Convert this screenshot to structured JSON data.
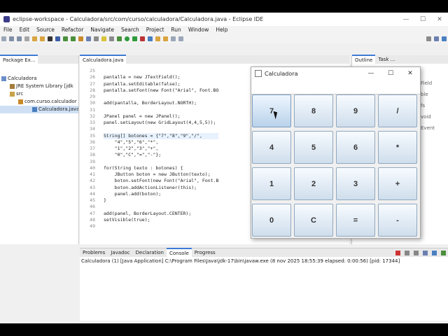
{
  "window": {
    "title": "eclipse-workspace - Calculadora/src/com/curso/calculadora/Calculadora.java - Eclipse IDE",
    "controls": [
      "—",
      "☐",
      "✕"
    ]
  },
  "menu": [
    "File",
    "Edit",
    "Source",
    "Refactor",
    "Navigate",
    "Search",
    "Project",
    "Run",
    "Window",
    "Help"
  ],
  "left_panel": {
    "tab_label": "Package Ex...",
    "tree": [
      {
        "label": "Calculadora",
        "indent": 0
      },
      {
        "label": "JRE System Library [jdk",
        "indent": 1
      },
      {
        "label": "src",
        "indent": 1
      },
      {
        "label": "com.curso.calculador",
        "indent": 2
      },
      {
        "label": "Calculadora.java",
        "indent": 3
      }
    ]
  },
  "editor": {
    "tab_label": "Calculadora.java",
    "line_numbers": [
      "25",
      "26",
      "27",
      "28",
      "29",
      "30",
      "31",
      "32",
      "33",
      "34",
      "35",
      "36",
      "37",
      "38",
      "39",
      "40",
      "41",
      "42",
      "43",
      "44",
      "45",
      "46",
      "47",
      "48",
      "49"
    ],
    "lines": [
      "",
      "pantalla = new JTextField();",
      "pantalla.setEditable(false);",
      "pantalla.setFont(new Font(\"Arial\", Font.BO",
      "",
      "add(pantalla, BorderLayout.NORTH);",
      "",
      "JPanel panel = new JPanel();",
      "panel.setLayout(new GridLayout(4,4,5,5));",
      "",
      "String[] botones = {\"7\",\"8\",\"9\",\"/\",",
      "    \"4\",\"5\",\"6\",\"*\",",
      "    \"1\",\"2\",\"3\",\"+\",",
      "    \"0\",\"C\",\"=\",\"-\"};",
      "",
      "for(String texto : botones) {",
      "    JButton boton = new JButton(texto);",
      "    boton.setFont(new Font(\"Arial\", Font.B",
      "    boton.addActionListener(this);",
      "    panel.add(boton);",
      "}",
      "",
      "add(panel, BorderLayout.CENTER);",
      "setVisible(true);",
      ""
    ]
  },
  "right_panel": {
    "tab_label": "Outline",
    "tab2_label": "Task ...",
    "snippets": [
      "Field",
      "ble",
      "fs",
      "void",
      "Event"
    ]
  },
  "bottom_panel": {
    "tabs": [
      "Problems",
      "Javadoc",
      "Declaration",
      "Console",
      "Progress"
    ],
    "console_line": "Calculadora (1) [Java Application] C:\\Program Files\\Java\\jdk-17\\bin\\javaw.exe (8 nov 2025 18:55:39 elapsed: 0:00:56) [pid: 17344]"
  },
  "calculator": {
    "title": "Calculadora",
    "controls": [
      "—",
      "☐",
      "✕"
    ],
    "display_value": "",
    "buttons": [
      [
        "7",
        "8",
        "9",
        "/"
      ],
      [
        "4",
        "5",
        "6",
        "*"
      ],
      [
        "1",
        "2",
        "3",
        "+"
      ],
      [
        "0",
        "C",
        "=",
        "-"
      ]
    ]
  },
  "colors": {
    "accent_tab": "#3d7ad6",
    "button_top": "#f7fbff",
    "button_bottom": "#cfdeec",
    "button_border": "#8fa8c0",
    "editor_highlight": "#e8f2fe"
  }
}
